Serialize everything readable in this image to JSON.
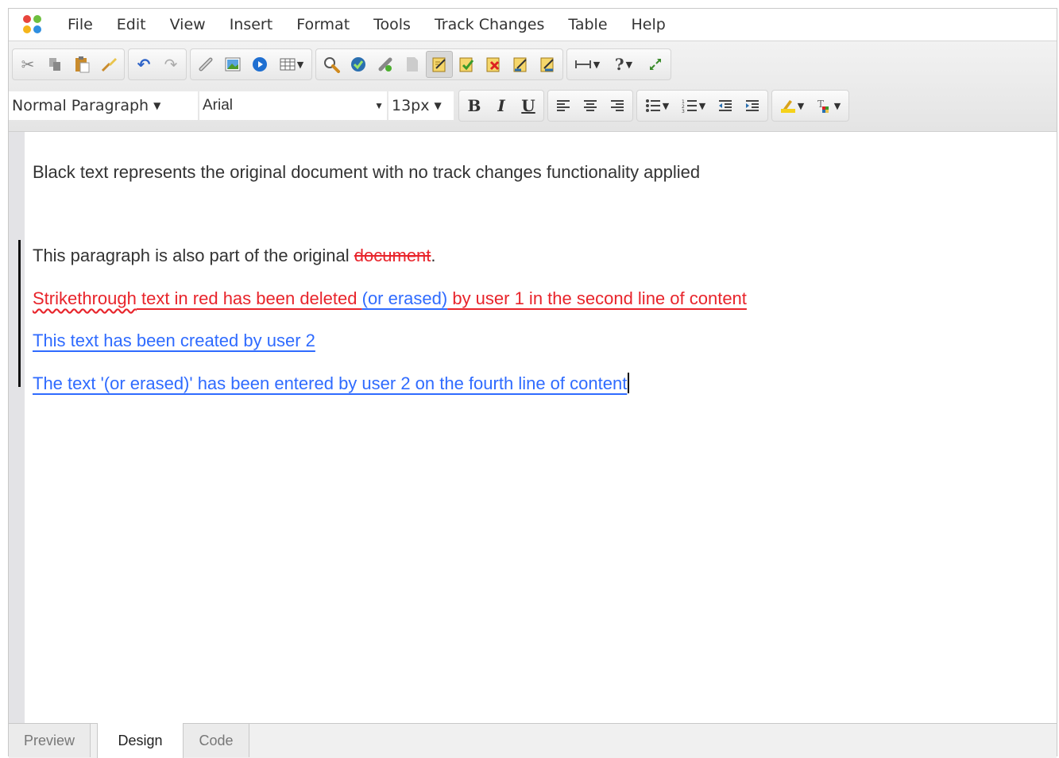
{
  "menubar": {
    "items": [
      "File",
      "Edit",
      "View",
      "Insert",
      "Format",
      "Tools",
      "Track Changes",
      "Table",
      "Help"
    ]
  },
  "toolbar": {
    "paragraph_style": "Normal Paragraph",
    "font_family": "Arial",
    "font_size": "13px",
    "bold_label": "B",
    "italic_label": "I",
    "underline_label": "U",
    "help_label": "?"
  },
  "document": {
    "line1": "Black text represents the original document with no track changes functionality applied",
    "line2_prefix": "This paragraph is also part of the original ",
    "line2_deleted": "document",
    "line2_suffix": ".",
    "line3_spell": "Strikethrough",
    "line3_red": " text in red has been deleted ",
    "line3_blue": "(or erased)",
    "line3_red_end": " by user 1 in the second line of content",
    "line4": "This text has been created by user 2",
    "line5": "The text '(or erased)' has been entered by user 2 on the fourth line of content"
  },
  "tabs": [
    "Preview",
    "Design",
    "Code"
  ],
  "colors": {
    "deleted": "#e8242b",
    "user2": "#2f6bff"
  }
}
